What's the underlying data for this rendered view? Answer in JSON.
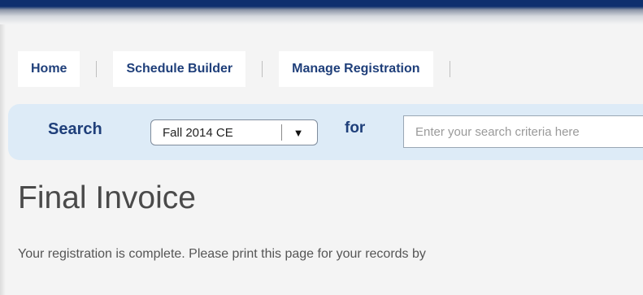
{
  "nav": {
    "tabs": [
      {
        "label": "Home"
      },
      {
        "label": "Schedule Builder"
      },
      {
        "label": "Manage Registration"
      }
    ]
  },
  "search": {
    "label": "Search",
    "term_selected": "Fall 2014 CE",
    "for_label": "for",
    "placeholder": "Enter your search criteria here"
  },
  "main": {
    "title": "Final Invoice",
    "message": "Your registration is complete. Please print this page for your records by"
  },
  "colors": {
    "header_navy": "#0e2f6e",
    "link_blue": "#1f3f7a",
    "search_bar_bg": "#ddebf7"
  },
  "icons": {
    "dropdown": "triangle-down-icon"
  }
}
